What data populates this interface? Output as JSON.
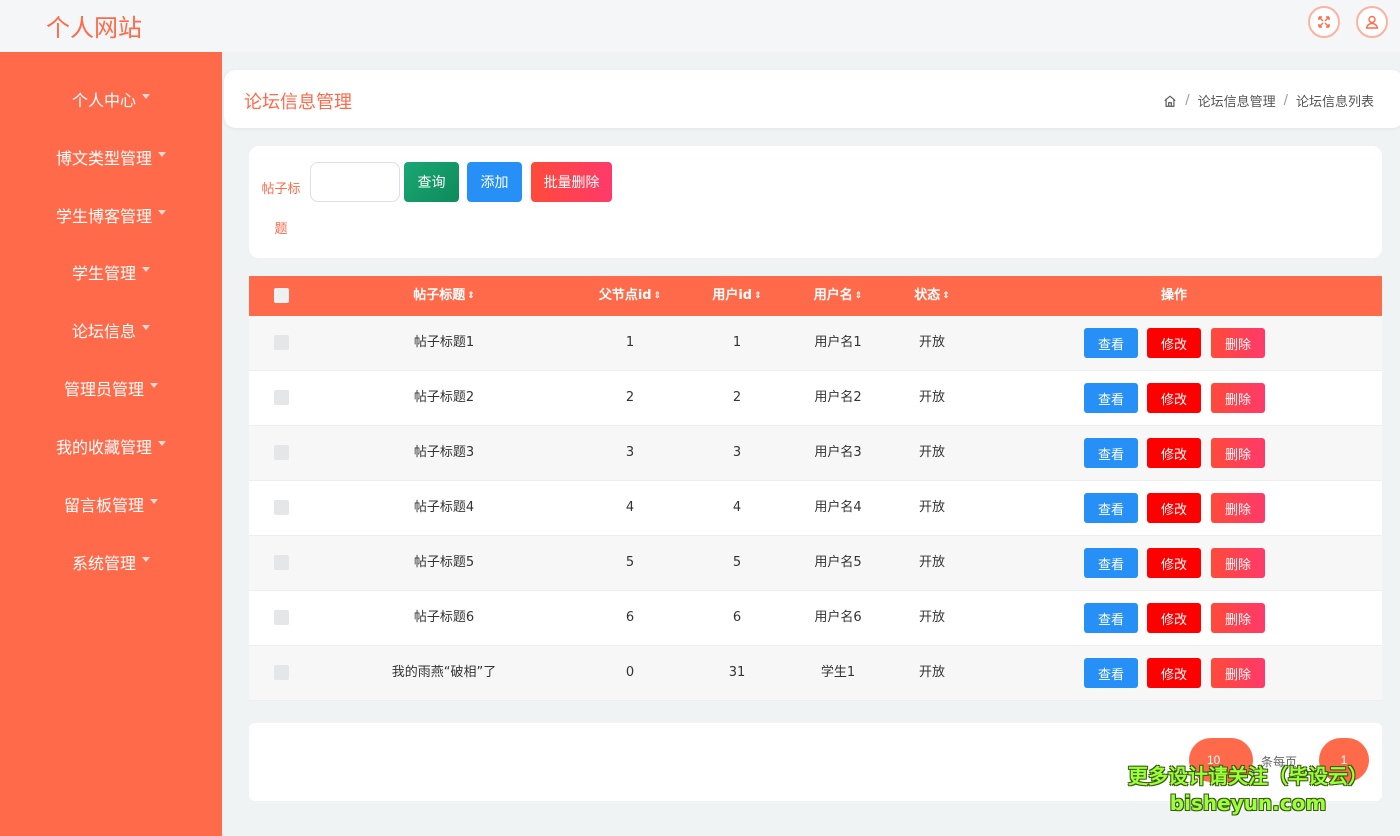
{
  "header": {
    "brand": "个人网站",
    "icons": [
      "fullscreen-icon",
      "user-icon"
    ]
  },
  "sidebar": {
    "items": [
      {
        "label": "个人中心"
      },
      {
        "label": "博文类型管理"
      },
      {
        "label": "学生博客管理"
      },
      {
        "label": "学生管理"
      },
      {
        "label": "论坛信息"
      },
      {
        "label": "管理员管理"
      },
      {
        "label": "我的收藏管理"
      },
      {
        "label": "留言板管理"
      },
      {
        "label": "系统管理"
      }
    ]
  },
  "page": {
    "title": "论坛信息管理",
    "breadcrumb": [
      "论坛信息管理",
      "论坛信息列表"
    ]
  },
  "search": {
    "label": "帖子标题",
    "value": "",
    "placeholder": "",
    "query_label": "查询",
    "add_label": "添加",
    "batch_delete_label": "批量删除"
  },
  "table": {
    "columns": {
      "title": "帖子标题",
      "parent_id": "父节点id",
      "user_id": "用户id",
      "username": "用户名",
      "status": "状态",
      "actions": "操作"
    },
    "action_labels": {
      "view": "查看",
      "edit": "修改",
      "delete": "删除"
    },
    "rows": [
      {
        "title": "帖子标题1",
        "parent_id": "1",
        "user_id": "1",
        "username": "用户名1",
        "status": "开放"
      },
      {
        "title": "帖子标题2",
        "parent_id": "2",
        "user_id": "2",
        "username": "用户名2",
        "status": "开放"
      },
      {
        "title": "帖子标题3",
        "parent_id": "3",
        "user_id": "3",
        "username": "用户名3",
        "status": "开放"
      },
      {
        "title": "帖子标题4",
        "parent_id": "4",
        "user_id": "4",
        "username": "用户名4",
        "status": "开放"
      },
      {
        "title": "帖子标题5",
        "parent_id": "5",
        "user_id": "5",
        "username": "用户名5",
        "status": "开放"
      },
      {
        "title": "帖子标题6",
        "parent_id": "6",
        "user_id": "6",
        "username": "用户名6",
        "status": "开放"
      },
      {
        "title": "我的雨燕“破相”了",
        "parent_id": "0",
        "user_id": "31",
        "username": "学生1",
        "status": "开放"
      }
    ]
  },
  "pagination": {
    "page_size": "10",
    "page_size_suffix": "条每页",
    "current_page": "1"
  },
  "watermark": {
    "line1": "更多设计请关注（毕设云）",
    "line2": "bisheyun.com"
  },
  "colors": {
    "accent": "#ff6a4a",
    "view": "#2690f7",
    "edit": "#ff0000",
    "query": "#0e8a5a"
  }
}
